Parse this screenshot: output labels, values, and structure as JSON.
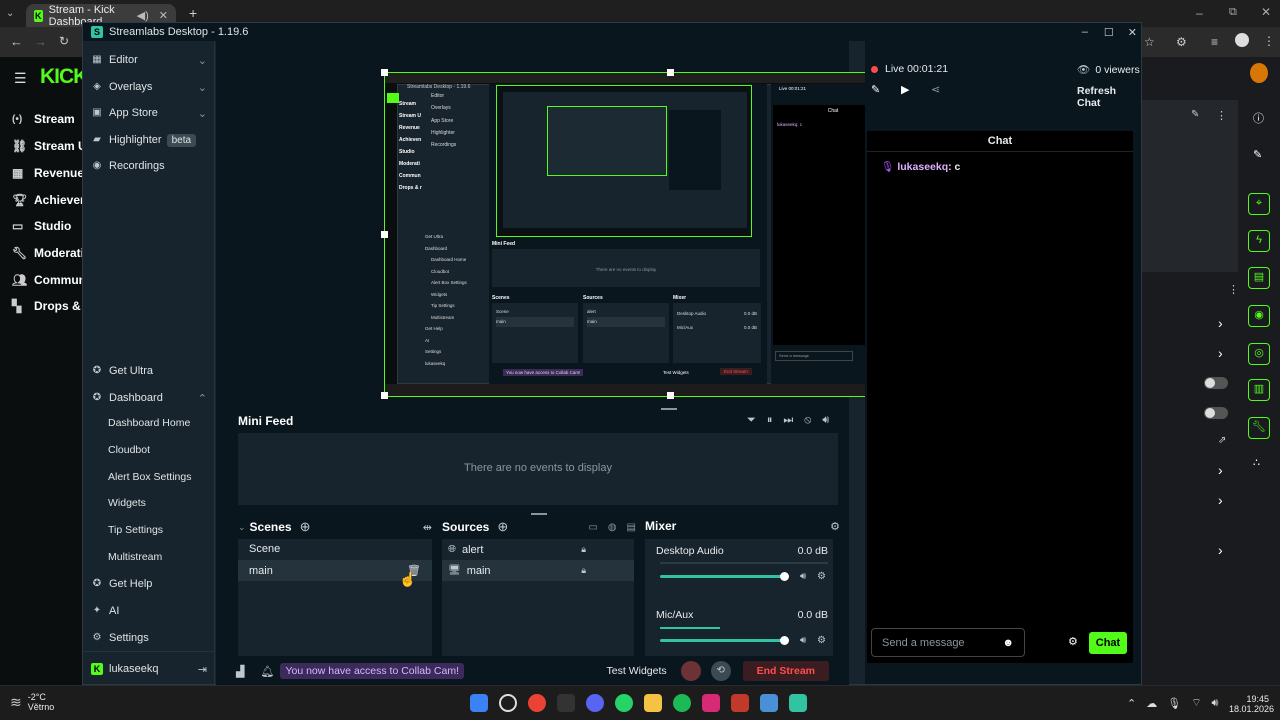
{
  "browser": {
    "tab_title": "Stream - Kick Dashboard",
    "new_tab_icon": "+"
  },
  "kick": {
    "nav": [
      {
        "label": "Stream",
        "icon": "stream-icon"
      },
      {
        "label": "Stream U",
        "icon": "link-icon"
      },
      {
        "label": "Revenue",
        "icon": "revenue-icon"
      },
      {
        "label": "Achieven",
        "icon": "trophy-icon"
      },
      {
        "label": "Studio",
        "icon": "monitor-icon"
      },
      {
        "label": "Moderati",
        "icon": "wrench-icon"
      },
      {
        "label": "Commun",
        "icon": "people-icon"
      },
      {
        "label": "Drops & r",
        "icon": "drops-icon"
      }
    ],
    "logo": "KICK"
  },
  "streamlabs": {
    "title": "Streamlabs Desktop - 1.19.6",
    "sidebar": {
      "top": [
        {
          "label": "Editor",
          "icon": "editor-icon"
        },
        {
          "label": "Overlays",
          "icon": "overlays-icon"
        },
        {
          "label": "App Store",
          "icon": "appstore-icon"
        },
        {
          "label": "Highlighter",
          "icon": "highlighter-icon",
          "badge": "beta"
        },
        {
          "label": "Recordings",
          "icon": "recordings-icon"
        }
      ],
      "get_ultra": "Get Ultra",
      "dashboard": "Dashboard",
      "dashboard_items": [
        "Dashboard Home",
        "Cloudbot",
        "Alert Box Settings",
        "Widgets",
        "Tip Settings",
        "Multistream"
      ],
      "bottom": [
        {
          "label": "Get Help",
          "icon": "help-icon"
        },
        {
          "label": "AI",
          "icon": "ai-icon"
        },
        {
          "label": "Settings",
          "icon": "gear-icon"
        }
      ],
      "user": "lukaseekq"
    },
    "minifeed": {
      "title": "Mini Feed",
      "empty": "There are no events to display"
    },
    "scenes": {
      "title": "Scenes",
      "items": [
        "Scene",
        "main"
      ]
    },
    "sources": {
      "title": "Sources",
      "items": [
        {
          "label": "alert",
          "icon": "globe-icon"
        },
        {
          "label": "main",
          "icon": "monitor-icon"
        }
      ]
    },
    "mixer": {
      "title": "Mixer",
      "channels": [
        {
          "name": "Desktop Audio",
          "level": "0.0 dB",
          "volume": 1.0
        },
        {
          "name": "Mic/Aux",
          "level": "0.0 dB",
          "volume": 1.0
        }
      ]
    },
    "footer": {
      "notice": "You now have access to Collab Cam!",
      "test_widgets": "Test Widgets",
      "end_stream": "End Stream"
    },
    "live": {
      "status": "Live 00:01:21",
      "viewers": "0 viewers",
      "refresh": "Refresh Chat"
    },
    "chat": {
      "title": "Chat",
      "messages": [
        {
          "user": "lukaseekq",
          "text": ": c"
        }
      ],
      "placeholder": "Send a message",
      "send": "Chat"
    },
    "preview_nested": {
      "title": "Streamlabs Desktop - 1.19.6",
      "minifeed": "Mini Feed",
      "empty": "There are no events to display",
      "scenes": "Scenes",
      "sources": "Sources",
      "mixer": "Mixer",
      "chat": "Chat",
      "send": "Send a message",
      "end": "End Stream",
      "test": "Test Widgets",
      "notice": "You now have access to Collab Cam!",
      "scene_items": [
        "Scene",
        "main"
      ],
      "source_items": [
        "alert",
        "main"
      ],
      "mixer_items": [
        "Desktop Audio",
        "Mic/Aux"
      ],
      "mixer_levels": [
        "0.0 dB",
        "0.0 dB"
      ],
      "live": "Live 00:01:21",
      "refresh": "Refresh Chat",
      "chat_user": "lukaseekq: c",
      "nav": [
        "Editor",
        "Overlays",
        "App Store",
        "Highlighter",
        "Recordings"
      ],
      "nav_lower": [
        "Get Ultra",
        "Dashboard",
        "Dashboard Home",
        "Cloudbot",
        "Alert Box Settings",
        "Widgets",
        "Tip Settings",
        "Multistream",
        "Get Help",
        "AI",
        "Settings",
        "lukaseekq"
      ],
      "kick_nav": [
        "Stream",
        "Stream U",
        "Revenue",
        "Achieven",
        "Studio",
        "Moderati",
        "Commun",
        "Drops & r"
      ]
    }
  },
  "taskbar": {
    "weather_temp": "-2°C",
    "weather_place": "Větrno",
    "time": "19:45",
    "date": "18.01.2026"
  }
}
